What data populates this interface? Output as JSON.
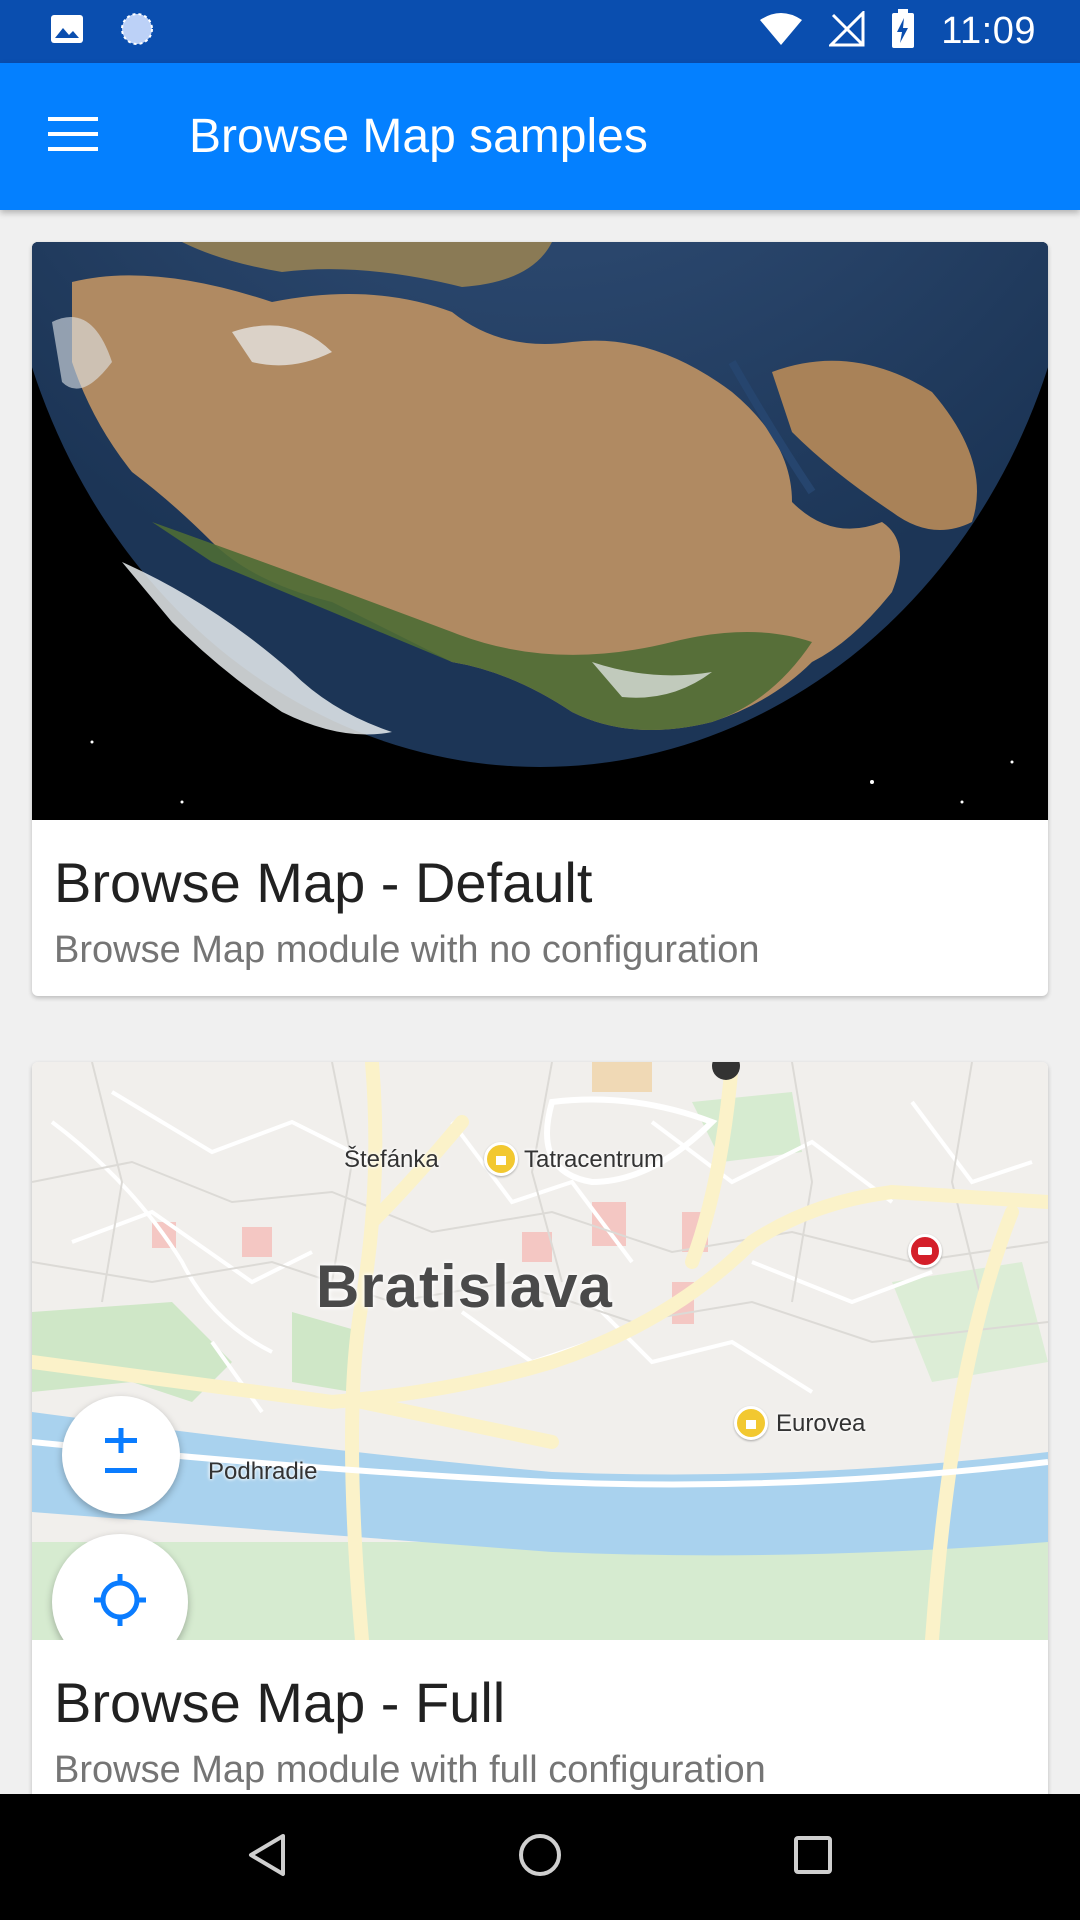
{
  "status_bar": {
    "time": "11:09",
    "icons": [
      "image-icon",
      "sync-icon",
      "wifi-icon",
      "no-signal-icon",
      "battery-charging-icon"
    ],
    "color": "#0a4eaf"
  },
  "app_bar": {
    "title": "Browse Map samples",
    "menu_icon": "hamburger-menu-icon",
    "color": "#0480ff"
  },
  "cards": [
    {
      "title": "Browse Map - Default",
      "description": "Browse Map module with no configuration",
      "image": "earth-globe-satellite-view"
    },
    {
      "title": "Browse Map - Full",
      "description": "Browse Map module with full configuration",
      "image": "street-map-bratislava",
      "map_labels": {
        "city": "Bratislava",
        "stefanka": "Štefánka",
        "tatracentrum": "Tatracentrum",
        "eurovea": "Eurovea",
        "podhradie": "Podhradie"
      },
      "controls": [
        "zoom-in-out-icon",
        "my-location-icon"
      ]
    }
  ],
  "nav_bar": {
    "buttons": [
      "back-triangle-icon",
      "home-circle-icon",
      "recents-square-icon"
    ]
  }
}
